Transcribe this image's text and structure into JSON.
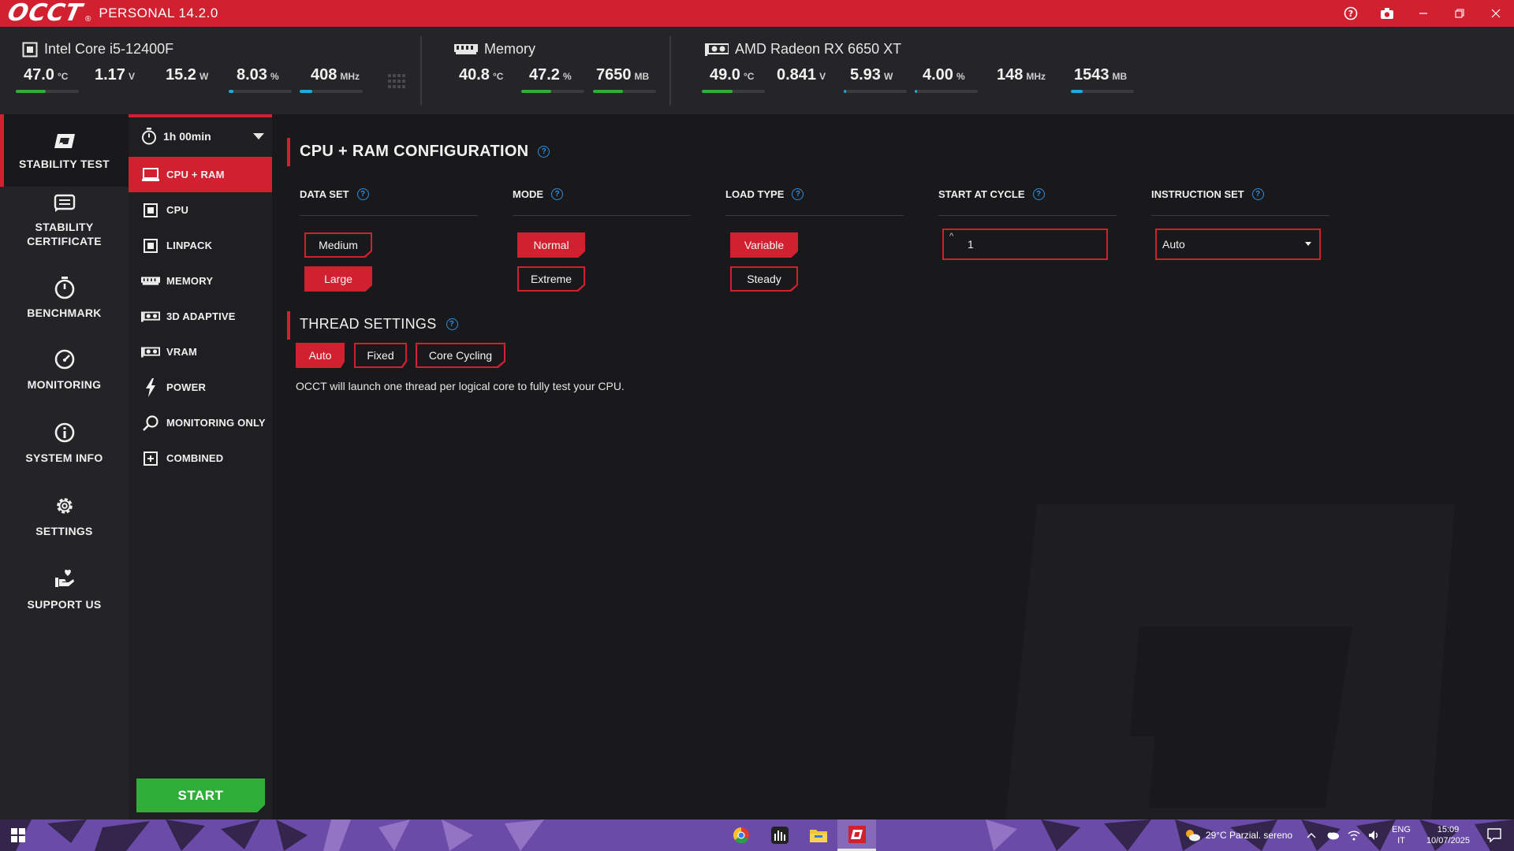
{
  "app": {
    "logo": "OCCT",
    "logo_mark": "®",
    "version": "PERSONAL 14.2.0"
  },
  "hardware": {
    "cpu": {
      "name": "Intel Core i5-12400F",
      "metrics": [
        {
          "value": "47.0",
          "unit": "°C",
          "bar_fraction": 0.47,
          "bar_color": "#2fae3a"
        },
        {
          "value": "1.17",
          "unit": "V"
        },
        {
          "value": "15.2",
          "unit": "W"
        },
        {
          "value": "8.03",
          "unit": "%",
          "bar_fraction": 0.08,
          "bar_color": "#23a8e0"
        },
        {
          "value": "408",
          "unit": "MHz",
          "bar_fraction": 0.2,
          "bar_color": "#23a8e0"
        }
      ]
    },
    "memory": {
      "name": "Memory",
      "metrics": [
        {
          "value": "40.8",
          "unit": "°C"
        },
        {
          "value": "47.2",
          "unit": "%",
          "bar_fraction": 0.47,
          "bar_color": "#2fae3a"
        },
        {
          "value": "7650",
          "unit": "MB",
          "bar_fraction": 0.47,
          "bar_color": "#2fae3a"
        }
      ]
    },
    "gpu": {
      "name": "AMD Radeon RX 6650 XT",
      "metrics": [
        {
          "value": "49.0",
          "unit": "°C",
          "bar_fraction": 0.49,
          "bar_color": "#2fae3a"
        },
        {
          "value": "0.841",
          "unit": "V"
        },
        {
          "value": "5.93",
          "unit": "W",
          "bar_fraction": 0.04,
          "bar_color": "#23a8e0"
        },
        {
          "value": "4.00",
          "unit": "%",
          "bar_fraction": 0.04,
          "bar_color": "#23a8e0"
        },
        {
          "value": "148",
          "unit": "MHz"
        },
        {
          "value": "1543",
          "unit": "MB",
          "bar_fraction": 0.19,
          "bar_color": "#23a8e0"
        }
      ]
    }
  },
  "nav": {
    "items": [
      {
        "label": "STABILITY TEST",
        "icon": "stability-test-icon"
      },
      {
        "label": "STABILITY CERTIFICATE",
        "icon": "certificate-icon"
      },
      {
        "label": "BENCHMARK",
        "icon": "stopwatch-icon"
      },
      {
        "label": "MONITORING",
        "icon": "gauge-icon"
      },
      {
        "label": "SYSTEM INFO",
        "icon": "info-icon"
      },
      {
        "label": "SETTINGS",
        "icon": "gear-icon"
      },
      {
        "label": "SUPPORT US",
        "icon": "heart-hand-icon"
      }
    ]
  },
  "submenu": {
    "duration": "1h 00min",
    "items": [
      {
        "label": "CPU + RAM",
        "icon": "monitor-icon"
      },
      {
        "label": "CPU",
        "icon": "cpu-icon"
      },
      {
        "label": "LINPACK",
        "icon": "linpack-icon"
      },
      {
        "label": "MEMORY",
        "icon": "memory-icon"
      },
      {
        "label": "3D ADAPTIVE",
        "icon": "gpu-icon"
      },
      {
        "label": "VRAM",
        "icon": "vram-icon"
      },
      {
        "label": "POWER",
        "icon": "lightning-icon"
      },
      {
        "label": "MONITORING ONLY",
        "icon": "magnifier-icon"
      },
      {
        "label": "COMBINED",
        "icon": "combined-icon"
      }
    ],
    "start_label": "START"
  },
  "config": {
    "title": "CPU + RAM CONFIGURATION",
    "data_set": {
      "label": "DATA SET",
      "options": [
        "Medium",
        "Large"
      ],
      "selected": "Large"
    },
    "mode": {
      "label": "MODE",
      "options": [
        "Normal",
        "Extreme"
      ],
      "selected": "Normal"
    },
    "load_type": {
      "label": "LOAD TYPE",
      "options": [
        "Variable",
        "Steady"
      ],
      "selected": "Variable"
    },
    "start_at_cycle": {
      "label": "START AT CYCLE",
      "value": "1",
      "spin": "^"
    },
    "instruction_set": {
      "label": "INSTRUCTION SET",
      "value": "Auto"
    }
  },
  "threads": {
    "title": "THREAD SETTINGS",
    "options": [
      "Auto",
      "Fixed",
      "Core Cycling"
    ],
    "selected": "Auto",
    "description": "OCCT will launch one thread per logical core to fully test your CPU."
  },
  "taskbar": {
    "weather": "29°C  Parzial. sereno",
    "lang_top": "ENG",
    "lang_bottom": "IT",
    "time": "15:09",
    "date": "10/07/2025"
  },
  "colors": {
    "accent": "#d1202f",
    "start": "#2fae3a",
    "help": "#2f8fe0",
    "taskbar": "#6b4ba8"
  }
}
